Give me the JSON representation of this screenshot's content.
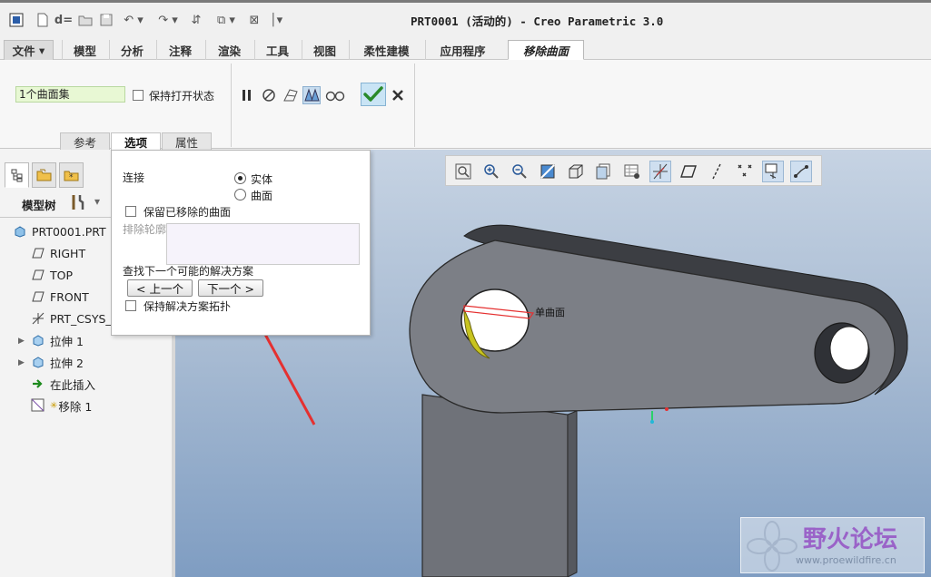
{
  "window": {
    "title": "PRT0001 (活动的) - Creo Parametric 3.0"
  },
  "ribbon": {
    "tabs": [
      "文件",
      "模型",
      "分析",
      "注释",
      "渲染",
      "工具",
      "视图",
      "柔性建模",
      "应用程序",
      "移除曲面"
    ],
    "active_tab": "移除曲面",
    "collector_value": "1个曲面集",
    "keep_open_label": "保持打开状态",
    "sub_tabs": [
      "参考",
      "选项",
      "属性"
    ],
    "active_sub_tab": "选项"
  },
  "options_panel": {
    "attach_label": "连接",
    "attach_options": [
      "实体",
      "曲面"
    ],
    "attach_selected": "实体",
    "keep_removed_label": "保留已移除的曲面",
    "exclude_contours_label": "排除轮廓",
    "find_next_label": "查找下一个可能的解决方案",
    "prev_button": "< 上一个",
    "next_button": "下一个 >",
    "keep_topology_label": "保持解决方案拓扑"
  },
  "model_tree": {
    "header": "模型树",
    "items": [
      {
        "label": "PRT0001.PRT",
        "icon": "part-icon"
      },
      {
        "label": "RIGHT",
        "icon": "datum-plane-icon"
      },
      {
        "label": "TOP",
        "icon": "datum-plane-icon"
      },
      {
        "label": "FRONT",
        "icon": "datum-plane-icon"
      },
      {
        "label": "PRT_CSYS_D",
        "icon": "csys-icon"
      },
      {
        "label": "拉伸 1",
        "icon": "extrude-icon"
      },
      {
        "label": "拉伸 2",
        "icon": "extrude-icon"
      },
      {
        "label": "在此插入",
        "icon": "insert-here-icon"
      },
      {
        "label": "移除 1",
        "icon": "remove-surface-icon"
      }
    ]
  },
  "viewport": {
    "annotation": "单曲面"
  },
  "watermark": {
    "name": "野火论坛",
    "url": "www.proewildfire.cn"
  },
  "colors": {
    "accent_green": "#2a8a2a",
    "model_gray": "#7a7d84",
    "highlight_yellow": "#c8c41e",
    "arrow_red": "#e53030"
  }
}
